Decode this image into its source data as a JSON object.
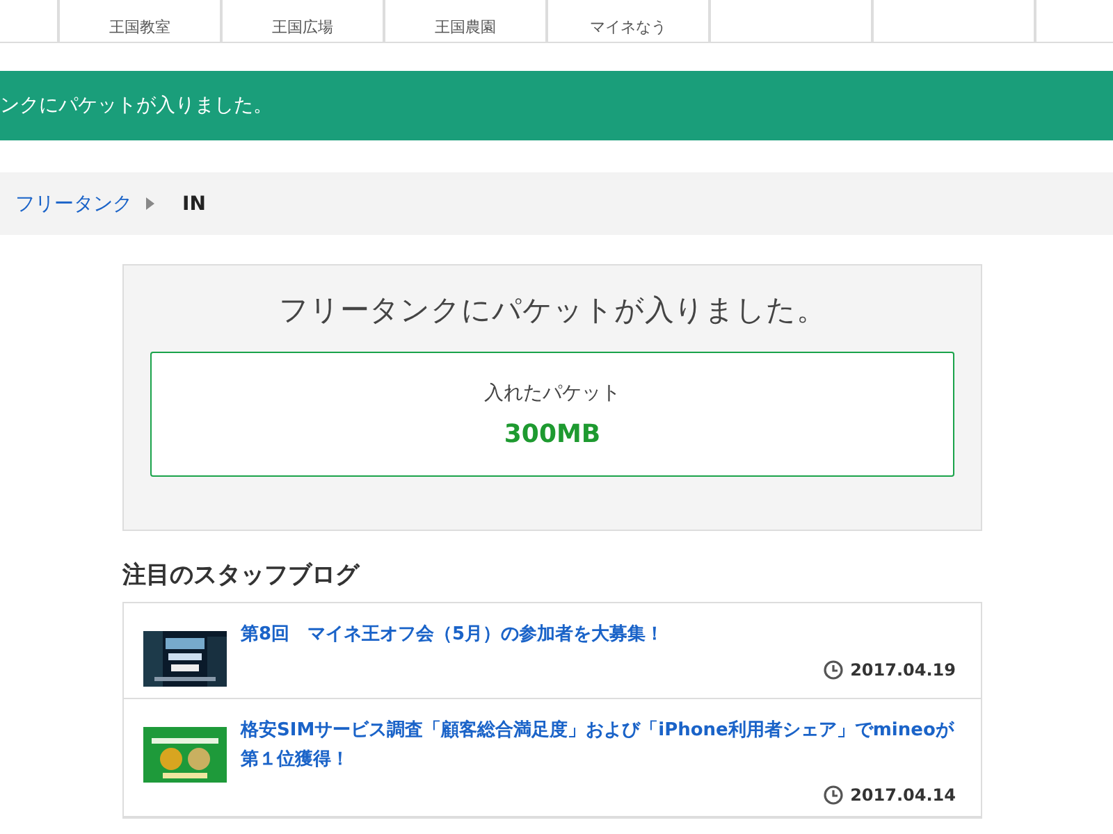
{
  "nav": [
    {
      "sublabel": "王国教室"
    },
    {
      "sublabel": "王国広場"
    },
    {
      "sublabel": "王国農園"
    },
    {
      "sublabel": "マイネなう"
    }
  ],
  "banner": {
    "text": "ンクにパケットが入りました。"
  },
  "breadcrumb": {
    "link": "フリータンク",
    "current": "IN"
  },
  "result": {
    "title": "フリータンクにパケットが入りました。",
    "label": "入れたパケット",
    "amount": "300MB"
  },
  "blog": {
    "heading": "注目のスタッフブログ",
    "posts": [
      {
        "title": "第8回　マイネ王オフ会（5月）の参加者を大募集！",
        "date": "2017.04.19"
      },
      {
        "title": "格安SIMサービス調査「顧客総合満足度」および「iPhone利用者シェア」でmineoが第１位獲得！",
        "date": "2017.04.14"
      }
    ]
  }
}
